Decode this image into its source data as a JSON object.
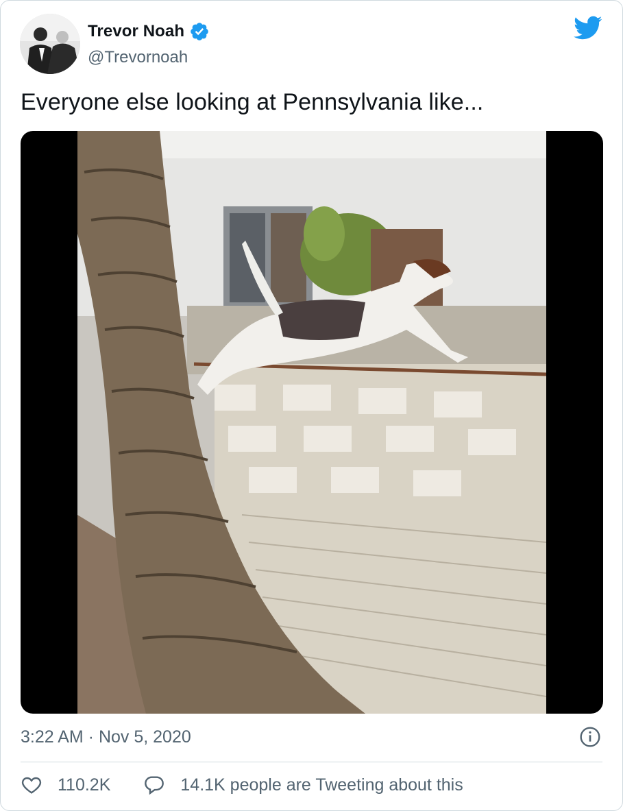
{
  "tweet": {
    "author": {
      "name": "Trevor Noah",
      "handle": "@Trevornoah",
      "verified": true,
      "avatar_icon": "profile-photo"
    },
    "text": "Everyone else looking at Pennsylvania like...",
    "media": {
      "type": "video",
      "icon": "video-thumbnail"
    },
    "timestamp": "3:22 AM · Nov 5, 2020",
    "likes": "110.2K",
    "tweeting_about": "14.1K people are Tweeting about this"
  },
  "colors": {
    "brand_blue": "#1d9bf0",
    "text_primary": "#0f1419",
    "text_secondary": "#536471",
    "border": "#cfd9de"
  },
  "icons": [
    "twitter-bird-icon",
    "verified-badge-icon",
    "info-icon",
    "heart-icon",
    "reply-bubble-icon"
  ]
}
